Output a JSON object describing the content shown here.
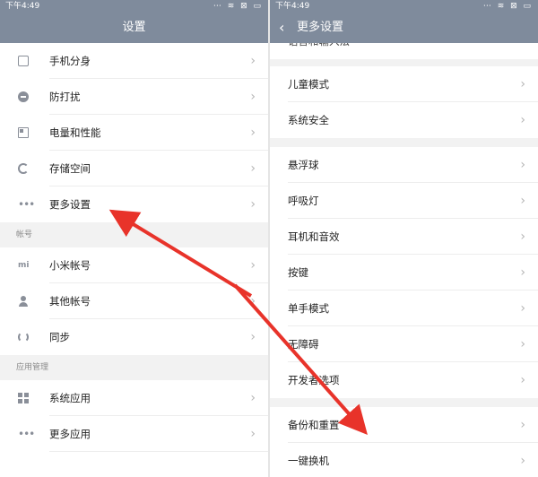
{
  "left": {
    "status_time": "下午4:49",
    "title": "设置",
    "items_top": [
      {
        "label": "手机分身",
        "icon": "phone-icon"
      },
      {
        "label": "防打扰",
        "icon": "do-not-disturb-icon"
      },
      {
        "label": "电量和性能",
        "icon": "battery-icon"
      },
      {
        "label": "存储空间",
        "icon": "storage-icon"
      },
      {
        "label": "更多设置",
        "icon": "more-dots-icon"
      }
    ],
    "section_accounts": "帐号",
    "items_accounts": [
      {
        "label": "小米帐号",
        "icon": "mi-logo-icon"
      },
      {
        "label": "其他帐号",
        "icon": "user-icon"
      },
      {
        "label": "同步",
        "icon": "sync-icon"
      }
    ],
    "section_apps": "应用管理",
    "items_apps": [
      {
        "label": "系统应用",
        "icon": "grid-icon"
      },
      {
        "label": "更多应用",
        "icon": "more-dots-icon"
      }
    ]
  },
  "right": {
    "status_time": "下午4:49",
    "title": "更多设置",
    "cutoff_item": "语言和输入法",
    "group1": [
      {
        "label": "儿童模式"
      },
      {
        "label": "系统安全"
      }
    ],
    "group2": [
      {
        "label": "悬浮球"
      },
      {
        "label": "呼吸灯"
      },
      {
        "label": "耳机和音效"
      },
      {
        "label": "按键"
      },
      {
        "label": "单手模式"
      },
      {
        "label": "无障碍"
      },
      {
        "label": "开发者选项"
      }
    ],
    "group3": [
      {
        "label": "备份和重置"
      },
      {
        "label": "一键换机"
      }
    ]
  },
  "colors": {
    "header": "#7f8b9c",
    "arrow": "#e8332a",
    "section_bg": "#f2f2f2"
  }
}
